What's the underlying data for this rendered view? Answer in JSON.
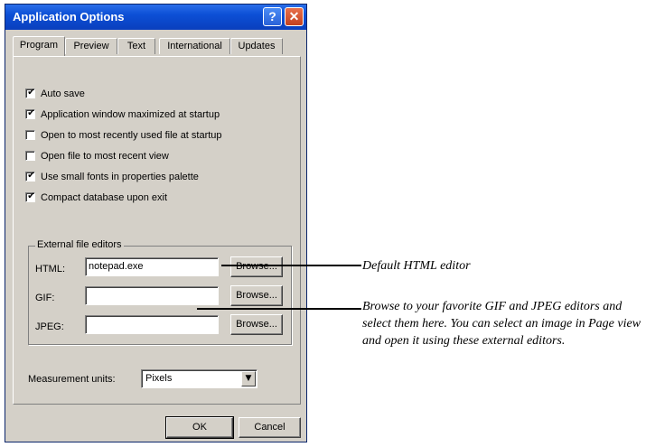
{
  "window": {
    "title": "Application Options",
    "help_button": "?",
    "close_button": "✕"
  },
  "tabs": [
    {
      "label": "Program"
    },
    {
      "label": "Preview"
    },
    {
      "label": "Text"
    },
    {
      "label": "International"
    },
    {
      "label": "Updates"
    }
  ],
  "options": [
    {
      "label": "Auto save",
      "checked": true
    },
    {
      "label": "Application window maximized at startup",
      "checked": true
    },
    {
      "label": "Open to most recently used file at startup",
      "checked": false
    },
    {
      "label": "Open file to most recent view",
      "checked": false
    },
    {
      "label": "Use small fonts in properties palette",
      "checked": true
    },
    {
      "label": "Compact database upon exit",
      "checked": true
    }
  ],
  "external_editors": {
    "group_title": "External file editors",
    "rows": [
      {
        "label": "HTML:",
        "value": "notepad.exe",
        "browse": "Browse..."
      },
      {
        "label": "GIF:",
        "value": "",
        "browse": "Browse..."
      },
      {
        "label": "JPEG:",
        "value": "",
        "browse": "Browse..."
      }
    ]
  },
  "measurement": {
    "label": "Measurement units:",
    "value": "Pixels",
    "arrow_icon": "▼"
  },
  "footer": {
    "ok_label": "OK",
    "cancel_label": "Cancel"
  },
  "annotations": {
    "html_editor": "Default HTML editor",
    "image_editors": "Browse to your favorite GIF and JPEG editors and select them here. You can select an image in Page view and open it using these external editors."
  },
  "check_mark": "✔"
}
